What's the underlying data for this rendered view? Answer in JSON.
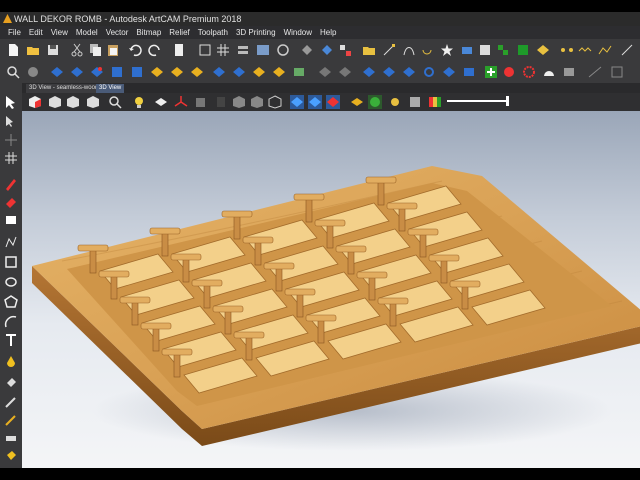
{
  "window": {
    "title": "WALL DEKOR ROMB - Autodesk ArtCAM Premium 2018"
  },
  "menu": [
    "File",
    "Edit",
    "View",
    "Model",
    "Vector",
    "Bitmap",
    "Relief",
    "Toolpath",
    "3D Printing",
    "Window",
    "Help"
  ],
  "tabs": [
    {
      "label": "3D View - seamless-wood1"
    },
    {
      "label": "3D View"
    }
  ],
  "colors": {
    "accent": "#4a5b78",
    "wood": "#d9a55a",
    "wood_dark": "#b27a36"
  }
}
